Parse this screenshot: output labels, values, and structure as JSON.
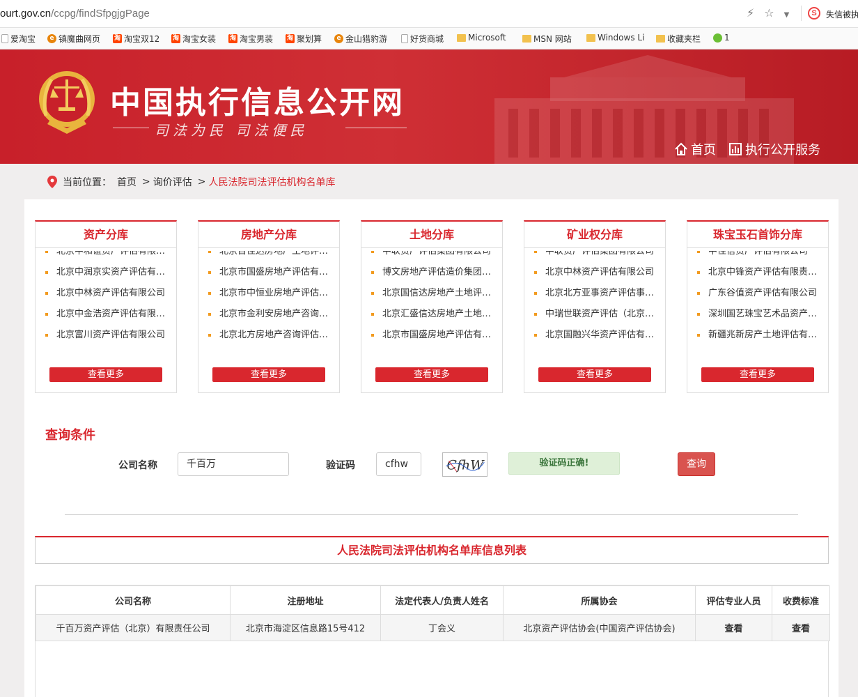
{
  "browser": {
    "url_host": "ourt.gov.cn",
    "url_path": "/ccpg/findSfpgjgPage",
    "news_text": "失信被执",
    "bookmarks": [
      {
        "label": "爱淘宝",
        "icon": "page-icon"
      },
      {
        "label": "镇魔曲网页",
        "icon": "ie-icon"
      },
      {
        "label": "淘宝双12",
        "icon": "taobao-icon"
      },
      {
        "label": "淘宝女装",
        "icon": "taobao-icon"
      },
      {
        "label": "淘宝男装",
        "icon": "taobao-icon"
      },
      {
        "label": "聚划算",
        "icon": "taobao-icon"
      },
      {
        "label": "金山猎豹游",
        "icon": "ie-icon"
      },
      {
        "label": "好货商城",
        "icon": "page-icon"
      },
      {
        "label": "Microsoft",
        "icon": "folder-icon"
      },
      {
        "label": "MSN 网站",
        "icon": "folder-icon"
      },
      {
        "label": "Windows Li",
        "icon": "folder-icon"
      },
      {
        "label": "收藏夹栏",
        "icon": "folder-icon"
      },
      {
        "label": "1",
        "icon": "green-icon"
      }
    ]
  },
  "header": {
    "title": "中国执行信息公开网",
    "slogan": "司法为民  司法便民",
    "nav_home": "首页",
    "nav_service": "执行公开服务"
  },
  "breadcrumb": {
    "label": "当前位置：",
    "home": "首页",
    "sep1": ">",
    "level2": "询价评估",
    "sep2": ">",
    "current": "人民法院司法评估机构名单库"
  },
  "categories": [
    {
      "title": "资产分库",
      "partial": "北京中和谊资产评估有限公司",
      "items": [
        "北京中润京实资产评估有限公司",
        "北京中林资产评估有限公司",
        "北京中金浩资产评估有限公司",
        "北京富川资产评估有限公司"
      ],
      "more": "查看更多"
    },
    {
      "title": "房地产分库",
      "partial": "北京首佳达房地产土地评估有限公司",
      "items": [
        "北京市国盛房地产评估有限公司",
        "北京市中恒业房地产评估有限公司",
        "北京市金利安房地产咨询评估有限公司",
        "北京北方房地产咨询评估有限公司"
      ],
      "more": "查看更多"
    },
    {
      "title": "土地分库",
      "partial": "中联资产评估集团有限公司",
      "items": [
        "博文房地产评估造价集团有限公司",
        "北京国信达房地产土地评估有限公司",
        "北京汇盛信达房地产土地评估有限公司",
        "北京市国盛房地产评估有限公司"
      ],
      "more": "查看更多"
    },
    {
      "title": "矿业权分库",
      "partial": "中联资产评估集团有限公司",
      "items": [
        "北京中林资产评估有限公司",
        "北京北方亚事资产评估事务所",
        "中瑞世联资产评估（北京）有限公司",
        "北京国融兴华资产评估有限公司"
      ],
      "more": "查看更多"
    },
    {
      "title": "珠宝玉石首饰分库",
      "partial": "中佳信资产评估有限公司",
      "items": [
        "北京中锋资产评估有限责任公司",
        "广东谷值资产评估有限公司",
        "深圳国艺珠宝艺术品资产评估有限公司",
        "新疆兆新房产土地评估有限公司"
      ],
      "more": "查看更多"
    }
  ],
  "query": {
    "title": "查询条件",
    "company_label": "公司名称",
    "company_value": "千百万",
    "captcha_label": "验证码",
    "captcha_value": "cfhw",
    "captcha_image_text": "CfhW",
    "captcha_ok": "验证码正确!",
    "submit": "查询"
  },
  "result": {
    "title": "人民法院司法评估机构名单库信息列表",
    "columns": [
      "公司名称",
      "注册地址",
      "法定代表人/负责人姓名",
      "所属协会",
      "评估专业人员",
      "收费标准"
    ],
    "rows": [
      [
        "千百万资产评估（北京）有限责任公司",
        "北京市海淀区信息路15号412",
        "丁会义",
        "北京资产评估协会(中国资产评估协会)",
        "查看",
        "查看"
      ]
    ]
  },
  "colors": {
    "brand_red": "#d9272e",
    "bullet_orange": "#f29b20",
    "success_green": "#dff0d8"
  }
}
